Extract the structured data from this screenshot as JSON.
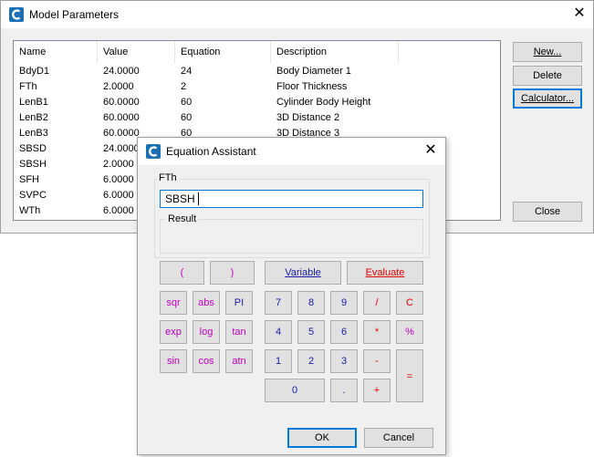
{
  "model_params": {
    "title": "Model Parameters",
    "columns": [
      "Name",
      "Value",
      "Equation",
      "Description"
    ],
    "rows": [
      {
        "name": "BdyD1",
        "value": "24.0000",
        "equation": "24",
        "description": "Body Diameter 1"
      },
      {
        "name": "FTh",
        "value": "2.0000",
        "equation": "2",
        "description": "Floor Thickness"
      },
      {
        "name": "LenB1",
        "value": "60.0000",
        "equation": "60",
        "description": "Cylinder Body Height"
      },
      {
        "name": "LenB2",
        "value": "60.0000",
        "equation": "60",
        "description": "3D Distance 2"
      },
      {
        "name": "LenB3",
        "value": "60.0000",
        "equation": "60",
        "description": "3D Distance 3"
      },
      {
        "name": "SBSD",
        "value": "24.0000",
        "equation": "",
        "description": ""
      },
      {
        "name": "SBSH",
        "value": "2.0000",
        "equation": "",
        "description": ""
      },
      {
        "name": "SFH",
        "value": "6.0000",
        "equation": "",
        "description": ""
      },
      {
        "name": "SVPC",
        "value": "6.0000",
        "equation": "",
        "description": ""
      },
      {
        "name": "WTh",
        "value": "6.0000",
        "equation": "",
        "description": ""
      }
    ],
    "buttons": {
      "new": "New...",
      "delete": "Delete",
      "calculator": "Calculator...",
      "close": "Close"
    }
  },
  "equation_assistant": {
    "title": "Equation Assistant",
    "group_label": "FTh",
    "input_value": "SBSH",
    "result_label": "Result",
    "keys": {
      "lparen": "(",
      "rparen": ")",
      "variable": "Variable",
      "evaluate": "Evaluate",
      "sqr": "sqr",
      "abs": "abs",
      "pi": "PI",
      "exp": "exp",
      "log": "log",
      "tan": "tan",
      "sin": "sin",
      "cos": "cos",
      "atn": "atn",
      "d7": "7",
      "d8": "8",
      "d9": "9",
      "d4": "4",
      "d5": "5",
      "d6": "6",
      "d1": "1",
      "d2": "2",
      "d3": "3",
      "d0": "0",
      "dot": ".",
      "div": "/",
      "clear": "C",
      "mul": "*",
      "pct": "%",
      "minus": "-",
      "plus": "+",
      "equals": "="
    },
    "ok": "OK",
    "cancel": "Cancel"
  },
  "colors": {
    "function_keys": "#c000c0",
    "digit_keys": "#1a1aa8",
    "operator_keys": "#e00000",
    "focus": "#0078d7"
  },
  "icons": {
    "app": "app-logo-icon",
    "close": "close-icon"
  }
}
